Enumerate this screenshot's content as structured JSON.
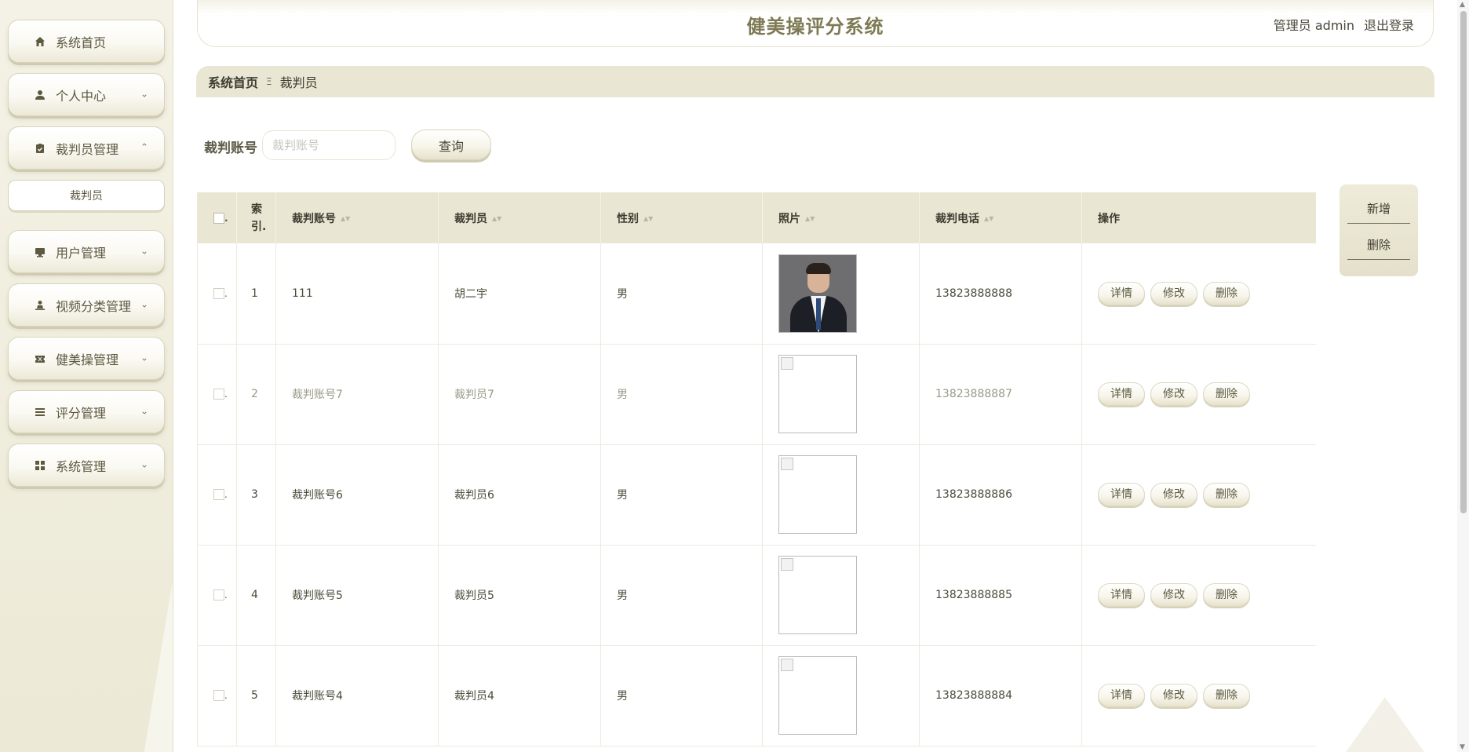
{
  "app": {
    "title": "健美操评分系统"
  },
  "header": {
    "user_label": "管理员 admin",
    "logout_label": "退出登录"
  },
  "sidebar": {
    "items": [
      {
        "label": "系统首页",
        "icon": "home-icon",
        "has_chevron": false
      },
      {
        "label": "个人中心",
        "icon": "user-icon",
        "has_chevron": true,
        "chevron": "⌄"
      },
      {
        "label": "裁判员管理",
        "icon": "clipboard-icon",
        "has_chevron": true,
        "chevron": "⌃"
      },
      {
        "label": "用户管理",
        "icon": "monitor-icon",
        "has_chevron": true,
        "chevron": "⌄"
      },
      {
        "label": "视频分类管理",
        "icon": "person-stand-icon",
        "has_chevron": true,
        "chevron": "⌄"
      },
      {
        "label": "健美操管理",
        "icon": "ticket-icon",
        "has_chevron": true,
        "chevron": "⌄"
      },
      {
        "label": "评分管理",
        "icon": "list-icon",
        "has_chevron": true,
        "chevron": "⌄"
      },
      {
        "label": "系统管理",
        "icon": "grid-icon",
        "has_chevron": true,
        "chevron": "⌄"
      }
    ],
    "submenu": {
      "label": "裁判员"
    }
  },
  "breadcrumb": {
    "home": "系统首页",
    "separator": "Ξ",
    "current": "裁判员"
  },
  "search": {
    "label": "裁判账号",
    "placeholder": "裁判账号",
    "value": "",
    "button_label": "查询"
  },
  "side_actions": {
    "add_label": "新增",
    "delete_label": "删除"
  },
  "table": {
    "headers": {
      "checkbox_dot": ".",
      "index": "索引.",
      "account": "裁判账号",
      "name": "裁判员",
      "gender": "性别",
      "photo": "照片",
      "phone": "裁判电话",
      "actions": "操作"
    },
    "sort_icon": "▲▼",
    "row_dot": ".",
    "rows": [
      {
        "index": "1",
        "account": "111",
        "name": "胡二宇",
        "gender": "男",
        "phone": "13823888888",
        "photo": "person"
      },
      {
        "index": "2",
        "account": "裁判账号7",
        "name": "裁判员7",
        "gender": "男",
        "phone": "13823888887",
        "photo": "broken"
      },
      {
        "index": "3",
        "account": "裁判账号6",
        "name": "裁判员6",
        "gender": "男",
        "phone": "13823888886",
        "photo": "broken"
      },
      {
        "index": "4",
        "account": "裁判账号5",
        "name": "裁判员5",
        "gender": "男",
        "phone": "13823888885",
        "photo": "broken"
      },
      {
        "index": "5",
        "account": "裁判账号4",
        "name": "裁判员4",
        "gender": "男",
        "phone": "13823888884",
        "photo": "broken"
      }
    ],
    "row_actions": {
      "detail": "详情",
      "edit": "修改",
      "delete": "删除"
    }
  },
  "colors": {
    "accent": "#7e7a54",
    "header_bg": "#e9e6d4",
    "sidebar_bg": "#f0eee0"
  }
}
